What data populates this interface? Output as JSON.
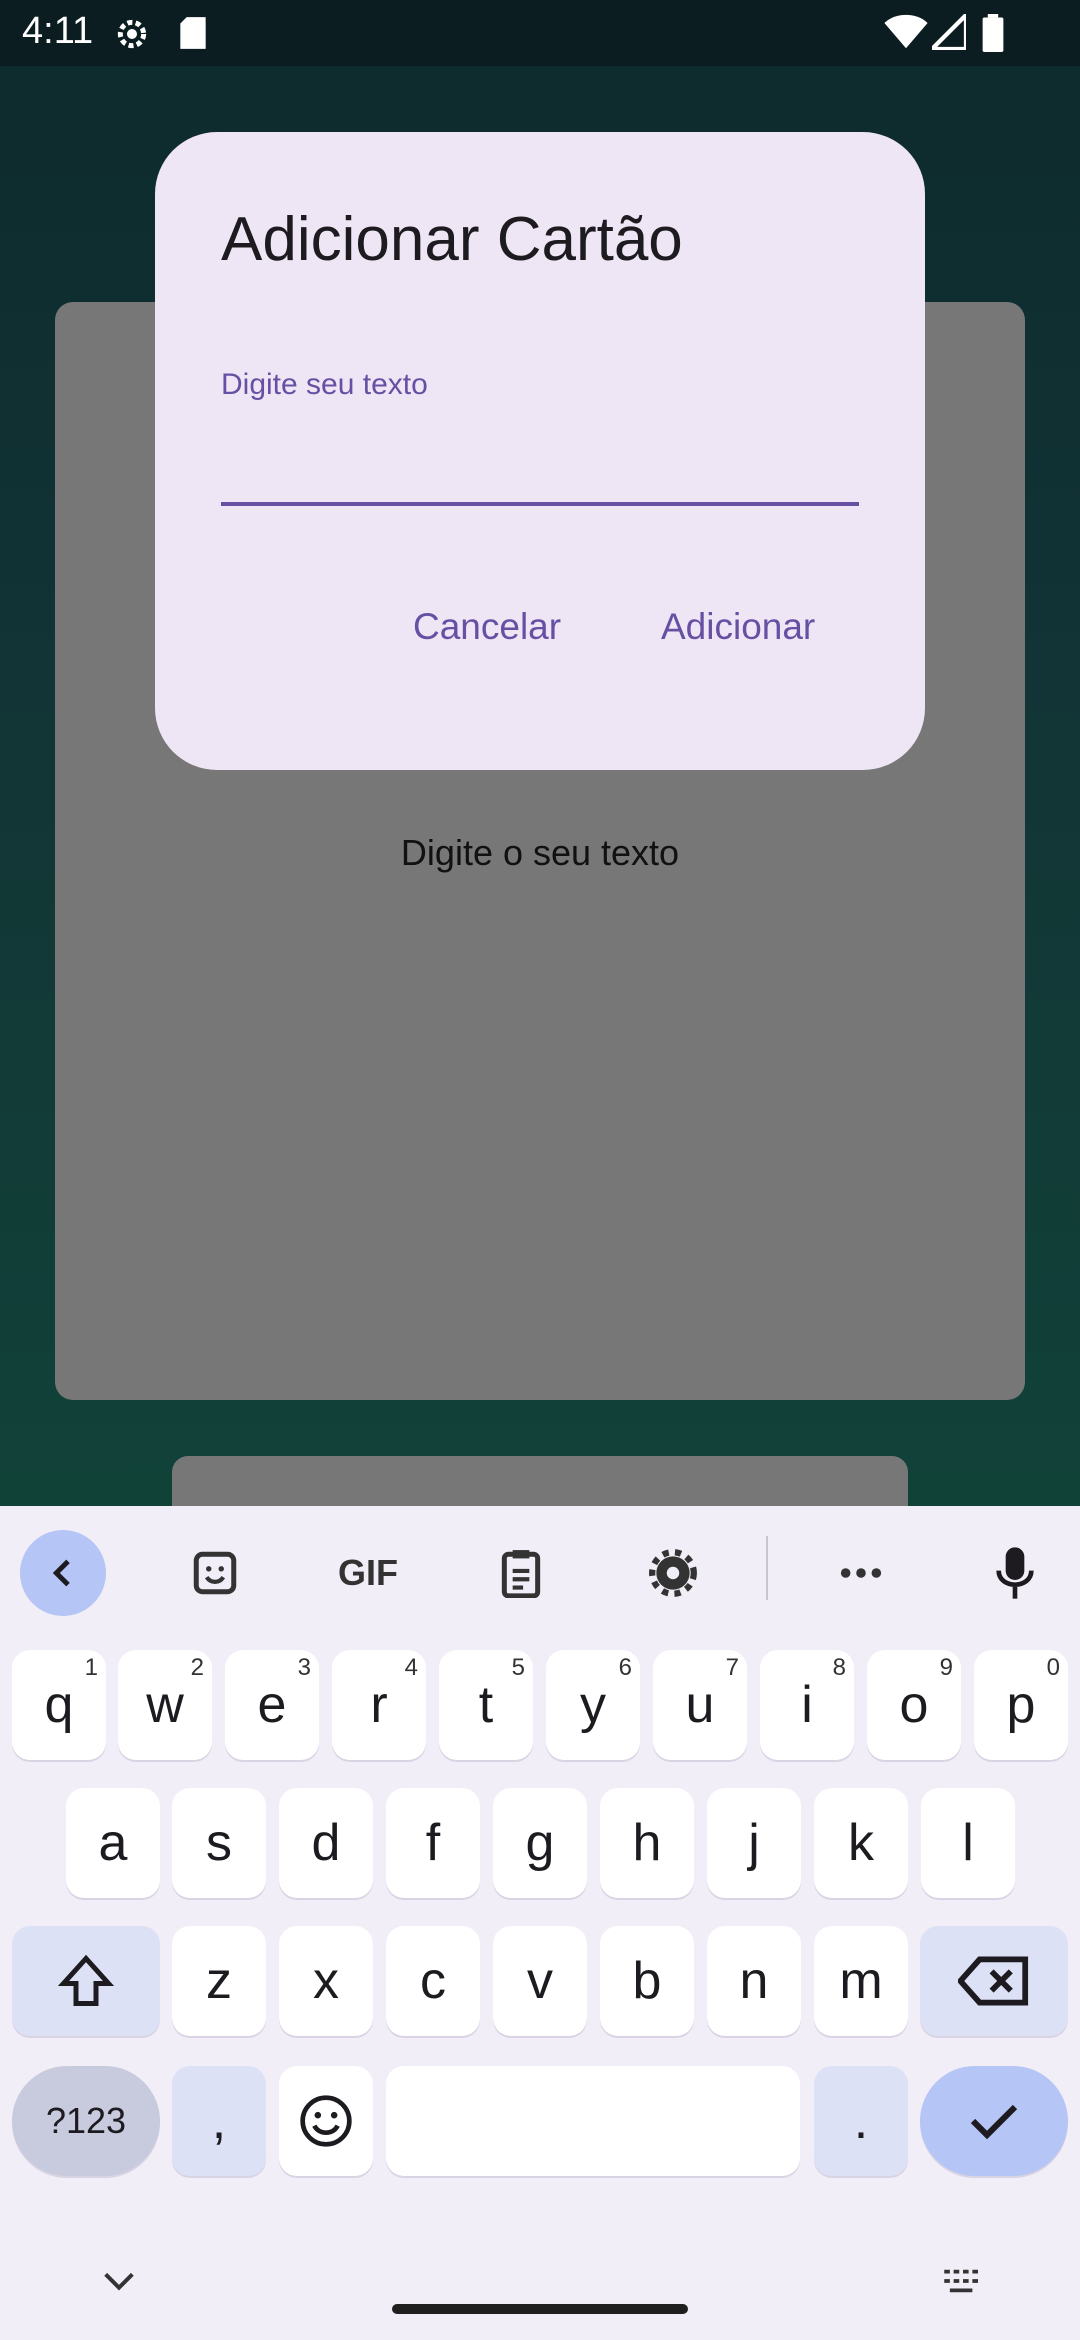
{
  "status_bar": {
    "time": "4:11",
    "icons": [
      "settings-gear-icon",
      "sd-card-icon",
      "wifi-icon",
      "signal-icon",
      "battery-icon"
    ]
  },
  "background_card": {
    "placeholder": "Digite o seu texto"
  },
  "dialog": {
    "title": "Adicionar Cartão",
    "field_label": "Digite seu texto",
    "field_value": "",
    "cancel_label": "Cancelar",
    "add_label": "Adicionar",
    "accent_color": "#6750a4"
  },
  "keyboard": {
    "toolbar": [
      "back-arrow-icon",
      "sticker-icon",
      "gif-icon",
      "clipboard-icon",
      "settings-icon",
      "more-icon",
      "microphone-icon"
    ],
    "gif_label": "GIF",
    "row1": [
      {
        "k": "q",
        "h": "1"
      },
      {
        "k": "w",
        "h": "2"
      },
      {
        "k": "e",
        "h": "3"
      },
      {
        "k": "r",
        "h": "4"
      },
      {
        "k": "t",
        "h": "5"
      },
      {
        "k": "y",
        "h": "6"
      },
      {
        "k": "u",
        "h": "7"
      },
      {
        "k": "i",
        "h": "8"
      },
      {
        "k": "o",
        "h": "9"
      },
      {
        "k": "p",
        "h": "0"
      }
    ],
    "row2": [
      "a",
      "s",
      "d",
      "f",
      "g",
      "h",
      "j",
      "k",
      "l"
    ],
    "row3": [
      "z",
      "x",
      "c",
      "v",
      "b",
      "n",
      "m"
    ],
    "symbols_label": "?123",
    "comma": ",",
    "period": ".",
    "accent_color": "#b4c5f6"
  }
}
